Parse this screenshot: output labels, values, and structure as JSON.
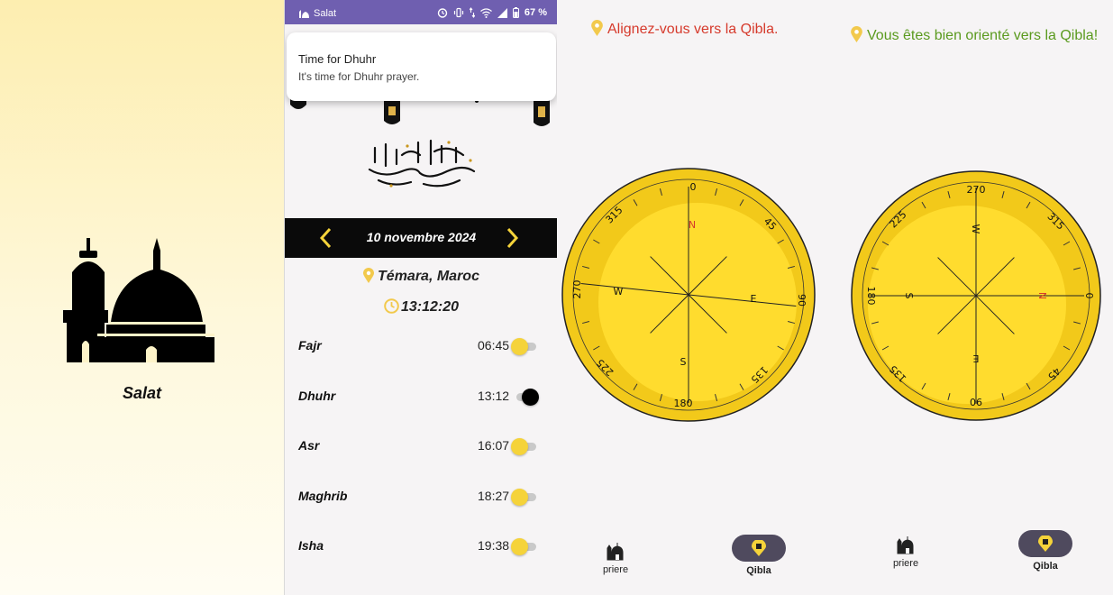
{
  "splash": {
    "title": "Salat"
  },
  "statusbar": {
    "app_name": "Salat",
    "battery": "67 %"
  },
  "notification": {
    "title": "Time for Dhuhr",
    "body": "It's time for Dhuhr prayer."
  },
  "date_nav": {
    "date": "10 novembre 2024"
  },
  "location": "Témara, Maroc",
  "current_time": "13:12:20",
  "prayers": [
    {
      "name": "Fajr",
      "time": "06:45",
      "enabled": false
    },
    {
      "name": "Dhuhr",
      "time": "13:12",
      "enabled": true
    },
    {
      "name": "Asr",
      "time": "16:07",
      "enabled": false
    },
    {
      "name": "Maghrib",
      "time": "18:27",
      "enabled": false
    },
    {
      "name": "Isha",
      "time": "19:38",
      "enabled": false
    }
  ],
  "qibla_left": {
    "message": "Alignez-vous vers la Qibla.",
    "message_color": "#d63a2c",
    "headings": {
      "top": "0",
      "right": "90",
      "bottom": "180",
      "left": "270",
      "top_right": "45",
      "bottom_right": "135",
      "bottom_left": "225",
      "top_left": "315"
    },
    "cardinals": {
      "north": "N",
      "east": "E",
      "south": "S",
      "west": "W"
    }
  },
  "qibla_right": {
    "message": "Vous êtes bien orienté vers la Qibla!",
    "message_color": "#5a9a1e",
    "headings": {
      "top": "270",
      "right": "0",
      "bottom": "90",
      "left": "180",
      "top_right": "315",
      "bottom_right": "45",
      "bottom_left": "135",
      "top_left": "225"
    },
    "cardinals": {
      "north": "N",
      "east": "E",
      "south": "S",
      "west": "W"
    }
  },
  "nav": {
    "prayer_label": "priere",
    "qibla_label": "Qibla"
  },
  "colors": {
    "accent_yellow": "#f5d33a",
    "compass_outer": "#f2c91a",
    "compass_inner": "#ffdc2e",
    "nav_pill": "#4f4a5e",
    "statusbar": "#6f5fb0"
  }
}
